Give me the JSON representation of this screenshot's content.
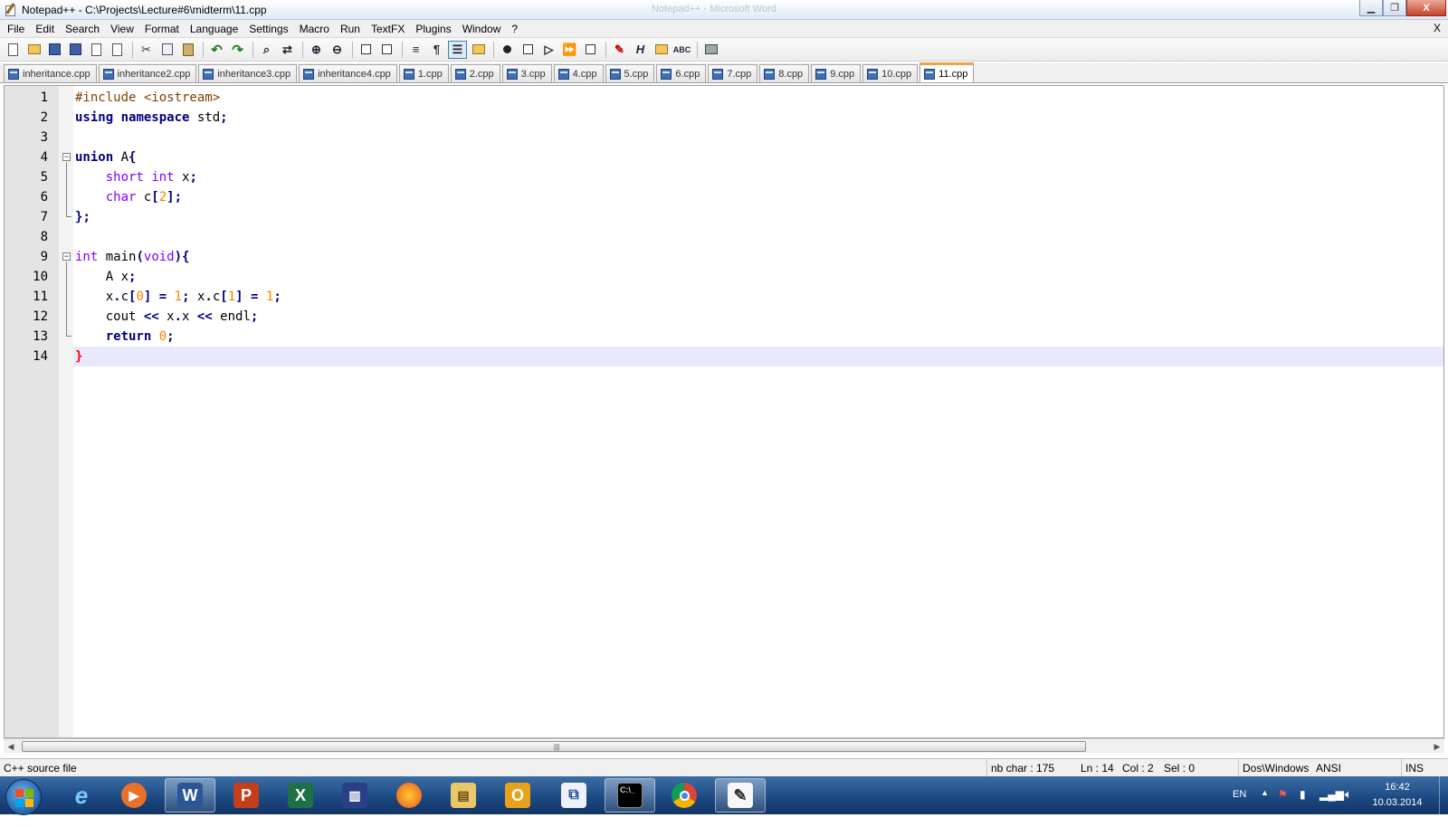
{
  "window": {
    "title": "Notepad++ - C:\\Projects\\Lecture#6\\midterm\\11.cpp",
    "ghost_title": "Notepad++ - Microsoft Word",
    "close_label": "X"
  },
  "menu": {
    "items": [
      "File",
      "Edit",
      "Search",
      "View",
      "Format",
      "Language",
      "Settings",
      "Macro",
      "Run",
      "TextFX",
      "Plugins",
      "Window",
      "?"
    ],
    "close_label": "X"
  },
  "toolbar": {
    "icons": [
      "new-file-icon",
      "open-file-icon",
      "save-icon",
      "save-all-icon",
      "close-icon",
      "close-all-icon",
      "print-icon",
      "cut-icon",
      "copy-icon",
      "paste-icon",
      "undo-icon",
      "redo-icon",
      "find-icon",
      "replace-icon",
      "zoom-in-icon",
      "zoom-out-icon",
      "sync-vertical-icon",
      "sync-horizontal-icon",
      "word-wrap-icon",
      "show-all-chars-icon",
      "indent-guide-icon",
      "doc-map-icon",
      "record-macro-icon",
      "stop-macro-icon",
      "play-macro-icon",
      "run-macro-multiple-icon",
      "save-macro-icon",
      "pdf-icon",
      "html-tag-icon",
      "folder-icon",
      "spell-check-icon",
      "printer-icon"
    ]
  },
  "tabs": [
    {
      "label": "inheritance.cpp",
      "active": false
    },
    {
      "label": "inheritance2.cpp",
      "active": false
    },
    {
      "label": "inheritance3.cpp",
      "active": false
    },
    {
      "label": "inheritance4.cpp",
      "active": false
    },
    {
      "label": "1.cpp",
      "active": false
    },
    {
      "label": "2.cpp",
      "active": false
    },
    {
      "label": "3.cpp",
      "active": false
    },
    {
      "label": "4.cpp",
      "active": false
    },
    {
      "label": "5.cpp",
      "active": false
    },
    {
      "label": "6.cpp",
      "active": false
    },
    {
      "label": "7.cpp",
      "active": false
    },
    {
      "label": "8.cpp",
      "active": false
    },
    {
      "label": "9.cpp",
      "active": false
    },
    {
      "label": "10.cpp",
      "active": false
    },
    {
      "label": "11.cpp",
      "active": true
    }
  ],
  "editor": {
    "current_line": 14,
    "lines": [
      {
        "n": "1",
        "text": "#include <iostream>"
      },
      {
        "n": "2",
        "text": "using namespace std;"
      },
      {
        "n": "3",
        "text": ""
      },
      {
        "n": "4",
        "text": "union A{"
      },
      {
        "n": "5",
        "text": "    short int x;"
      },
      {
        "n": "6",
        "text": "    char c[2];"
      },
      {
        "n": "7",
        "text": "};"
      },
      {
        "n": "8",
        "text": ""
      },
      {
        "n": "9",
        "text": "int main(void){"
      },
      {
        "n": "10",
        "text": "    A x;"
      },
      {
        "n": "11",
        "text": "    x.c[0] = 1; x.c[1] = 1;"
      },
      {
        "n": "12",
        "text": "    cout << x.x << endl;"
      },
      {
        "n": "13",
        "text": "    return 0;"
      },
      {
        "n": "14",
        "text": "}"
      }
    ]
  },
  "scrollbar": {
    "grip": "|||"
  },
  "status": {
    "file_type": "C++ source file",
    "nb_char": "nb char : 175",
    "ln": "Ln : 14",
    "col": "Col : 2",
    "sel": "Sel : 0",
    "eol": "Dos\\Windows",
    "encoding": "ANSI",
    "mode": "INS"
  },
  "taskbar": {
    "apps": [
      "start-button",
      "internet-explorer",
      "media-player",
      "word",
      "powerpoint",
      "excel",
      "library",
      "firefox",
      "file-explorer",
      "outlook",
      "visual-studio",
      "command-prompt",
      "chrome",
      "notepad-plus-plus"
    ],
    "language": "EN",
    "time": "16:42",
    "date": "10.03.2014"
  }
}
